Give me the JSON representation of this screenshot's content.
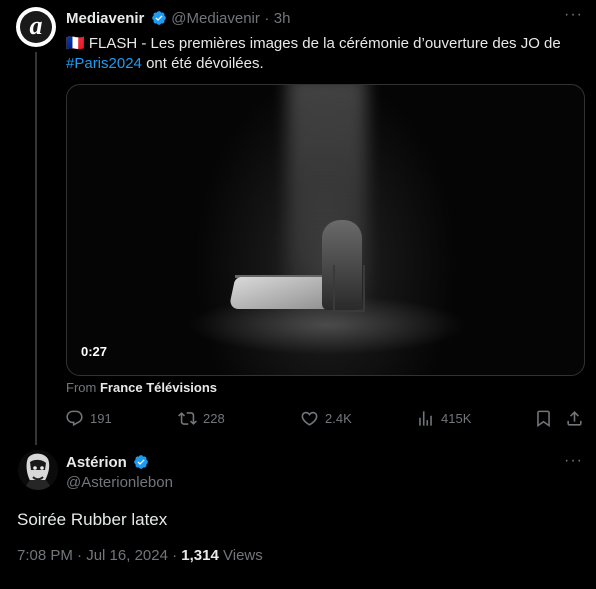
{
  "tweet": {
    "author": "Mediavenir",
    "handle": "@Mediavenir",
    "separator": "·",
    "time": "3h",
    "avatar_letter": "a",
    "flag": "🇫🇷",
    "text_before": "FLASH - Les premières images de la cérémonie d’ouverture des JO de",
    "hashtag": "#Paris2024",
    "text_after": "ont été dévoilées.",
    "video_duration": "0:27",
    "from_prefix": "From",
    "from_source": "France Télévisions",
    "more": "···",
    "actions": {
      "replies": "191",
      "reposts": "228",
      "likes": "2.4K",
      "views": "415K"
    }
  },
  "reply": {
    "author": "Astérion",
    "handle": "@Asterionlebon",
    "more": "···",
    "text": "Soirée Rubber latex",
    "time": "7:08 PM",
    "date_sep": "·",
    "date": "Jul 16, 2024",
    "views_sep": "·",
    "views_count": "1,314",
    "views_label": "Views"
  },
  "colors": {
    "background": "#000000",
    "text": "#e7e9ea",
    "muted": "#71767b",
    "accent": "#1d9bf0",
    "border": "#2f3336"
  }
}
